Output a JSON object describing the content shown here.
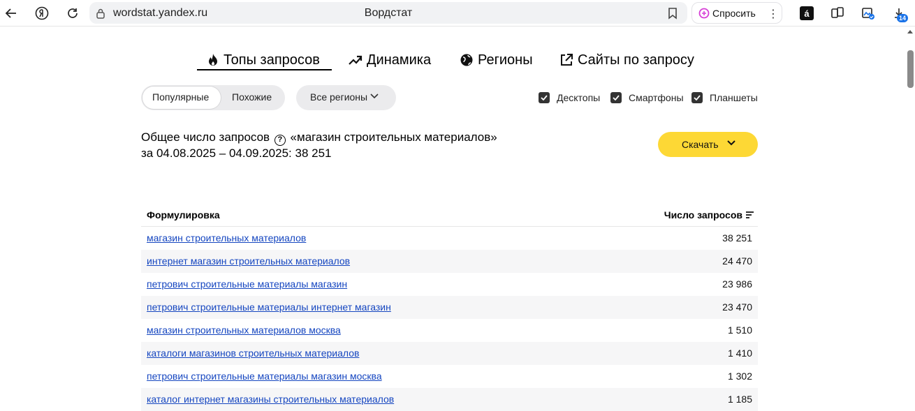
{
  "browser": {
    "domain": "wordstat.yandex.ru",
    "title": "Вордстат",
    "ask_label": "Спросить",
    "ask_more": "⋮",
    "download_badge": "14"
  },
  "tabs": [
    {
      "label": "Топы запросов",
      "icon": "fire-icon",
      "active": true
    },
    {
      "label": "Динамика",
      "icon": "trend-icon",
      "active": false
    },
    {
      "label": "Регионы",
      "icon": "globe-icon",
      "active": false
    },
    {
      "label": "Сайты по запросу",
      "icon": "external-link-icon",
      "active": false
    }
  ],
  "filters": {
    "mode_popular": "Популярные",
    "mode_similar": "Похожие",
    "region": "Все регионы",
    "devices": [
      {
        "label": "Десктопы",
        "checked": true
      },
      {
        "label": "Смартфоны",
        "checked": true
      },
      {
        "label": "Планшеты",
        "checked": true
      }
    ]
  },
  "summary": {
    "prefix": "Общее число запросов",
    "query": "«магазин строительных материалов»",
    "period": "за 04.08.2025 – 04.09.2025: 38 251"
  },
  "download_label": "Скачать",
  "table": {
    "col_phrase": "Формулировка",
    "col_count": "Число запросов",
    "rows": [
      {
        "phrase": "магазин строительных материалов",
        "count": "38 251"
      },
      {
        "phrase": "интернет магазин строительных материалов",
        "count": "24 470"
      },
      {
        "phrase": "петрович строительные материалы магазин",
        "count": "23 986"
      },
      {
        "phrase": "петрович строительные материалы интернет магазин",
        "count": "23 470"
      },
      {
        "phrase": "магазин строительных материалов москва",
        "count": "1 510"
      },
      {
        "phrase": "каталоги магазинов строительных материалов",
        "count": "1 410"
      },
      {
        "phrase": "петрович строительные материалы магазин москва",
        "count": "1 302"
      },
      {
        "phrase": "каталог интернет магазины строительных материалов",
        "count": "1 185"
      }
    ]
  },
  "colors": {
    "link": "#1546c0",
    "accent_yellow": "#fdd835",
    "chip_bg": "#ebebed"
  }
}
